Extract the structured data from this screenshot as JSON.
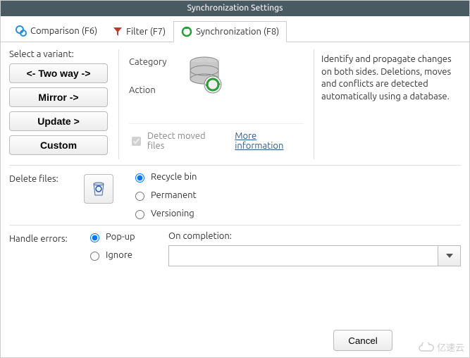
{
  "window": {
    "title": "Synchronization Settings"
  },
  "tabs": {
    "comparison": "Comparison (F6)",
    "filter": "Filter (F7)",
    "synchronization": "Synchronization (F8)"
  },
  "variant": {
    "label": "Select a variant:",
    "two_way": "<- Two way ->",
    "mirror": "Mirror ->",
    "update": "Update >",
    "custom": "Custom"
  },
  "mid": {
    "category": "Category",
    "action": "Action",
    "detect": "Detect moved files",
    "more": "More information"
  },
  "description": "Identify and propagate changes on both sides. Deletions, moves and conflicts are detected automatically using a database.",
  "delete": {
    "label": "Delete files:",
    "recycle": "Recycle bin",
    "permanent": "Permanent",
    "versioning": "Versioning"
  },
  "errors": {
    "label": "Handle errors:",
    "popup": "Pop-up",
    "ignore": "Ignore"
  },
  "completion": {
    "label": "On completion:"
  },
  "footer": {
    "cancel": "Cancel"
  },
  "watermark": "亿速云"
}
